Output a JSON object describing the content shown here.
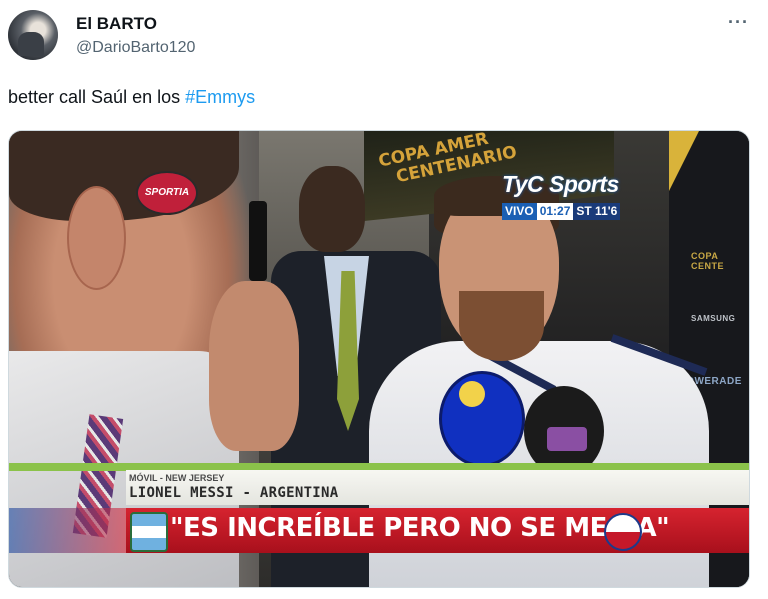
{
  "post": {
    "display_name": "El BARTO",
    "handle": "@DarioBarto120",
    "more_label": "···",
    "text_prefix": "better call Saúl en los ",
    "hashtag": "#Emmys"
  },
  "media": {
    "broadcaster_logo": "TyC Sports",
    "live_label": "VIVO",
    "clock": "01:27",
    "period": "ST 11'6",
    "mic_flag_label": "SPORTIA",
    "venue_banner_line1": "COPA AMER",
    "venue_banner_line2": "CENTENARIO",
    "sponsor_1": "COPA CENTE",
    "sponsor_2": "SAMSUNG",
    "sponsor_3": "POWERADE",
    "location": "MÓVIL - NEW JERSEY",
    "player": "LIONEL MESSI - ARGENTINA",
    "quote": "\"ES INCREÍBLE PERO NO SE ME DA\"",
    "colors": {
      "hashtag": "#1d9bf0",
      "quote_bar": "#d6232f",
      "tyc_blue": "#1a5fb4",
      "green_strip": "#8bc24a"
    },
    "icons": [
      "avatar",
      "more-options-icon",
      "argentina-flag-icon",
      "chile-flag-icon"
    ]
  }
}
